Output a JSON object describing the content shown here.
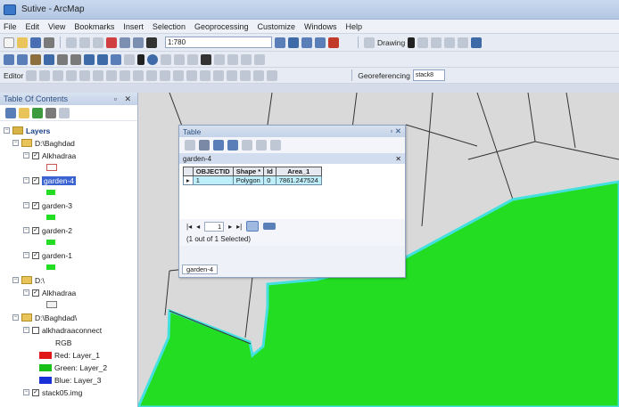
{
  "window": {
    "title": "Sutive - ArcMap"
  },
  "menu": [
    "File",
    "Edit",
    "View",
    "Bookmarks",
    "Insert",
    "Selection",
    "Geoprocessing",
    "Customize",
    "Windows",
    "Help"
  ],
  "toolbar": {
    "scale_value": "1:780",
    "drawing_label": "Drawing",
    "editor_label": "Editor",
    "georeferencing_label": "Georeferencing",
    "georef_layer": "stack8"
  },
  "toc": {
    "title": "Table Of Contents",
    "rows": [
      {
        "label": "Layers"
      },
      {
        "label": "D:\\Baghdad"
      },
      {
        "label": "Alkhadraa"
      },
      {
        "label": "garden-4"
      },
      {
        "label": "garden-3"
      },
      {
        "label": "garden-2"
      },
      {
        "label": "garden-1"
      },
      {
        "label": "D:\\"
      },
      {
        "label": "Alkhadraa"
      },
      {
        "label": "D:\\Baghdad\\"
      },
      {
        "label": "alkhadraaconnect"
      },
      {
        "label": "RGB"
      },
      {
        "label": "Red: Layer_1"
      },
      {
        "label": "Green: Layer_2"
      },
      {
        "label": "Blue: Layer_3"
      },
      {
        "label": "stack05.img"
      }
    ]
  },
  "table_window": {
    "title": "Table",
    "tab_name": "garden-4",
    "columns": [
      "OBJECTID",
      "Shape *",
      "Id",
      "Area_1"
    ],
    "row": [
      "1",
      "Polygon",
      "0",
      "7861.247524"
    ],
    "record_number": "1",
    "status": "(1 out of 1 Selected)",
    "bottom_tab": "garden-4"
  },
  "colors": {
    "polygon_fill": "#22dd22",
    "polygon_outline": "#44e0e0",
    "map_background": "#d9d9d9",
    "selection_row": "#bfeefb"
  }
}
